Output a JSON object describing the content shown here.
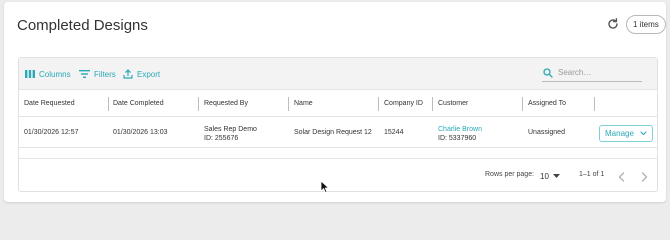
{
  "page": {
    "title": "Completed Designs",
    "items_badge": "1 items"
  },
  "toolbar": {
    "columns_label": "Columns",
    "filters_label": "Filters",
    "export_label": "Export",
    "search_placeholder": "Search…"
  },
  "table": {
    "headers": {
      "date_requested": "Date Requested",
      "date_completed": "Date Completed",
      "requested_by": "Requested By",
      "name": "Name",
      "company_id": "Company ID",
      "customer": "Customer",
      "assigned_to": "Assigned To"
    },
    "rows": [
      {
        "date_requested": "01/30/2026 12:57",
        "date_completed": "01/30/2026 13:03",
        "requested_by_name": "Sales Rep Demo",
        "requested_by_id": "ID: 255676",
        "name": "Solar Design Request 12",
        "company_id": "15244",
        "customer_name": "Charlie Brown",
        "customer_id": "ID: 5337960",
        "assigned_to": "Unassigned",
        "action_label": "Manage"
      }
    ]
  },
  "footer": {
    "rows_per_page_label": "Rows per page:",
    "rows_per_page_value": "10",
    "range_text": "1–1 of 1"
  },
  "colors": {
    "accent": "#2aa9b8",
    "border": "#e0e0e0",
    "toolbar_bg": "#f3f3f3"
  },
  "icons": {
    "refresh": "refresh-icon",
    "columns": "columns-icon",
    "filters": "filter-icon",
    "export": "export-icon",
    "search": "search-icon",
    "dropdown": "chevron-down-icon",
    "prev": "chevron-left-icon",
    "next": "chevron-right-icon"
  }
}
